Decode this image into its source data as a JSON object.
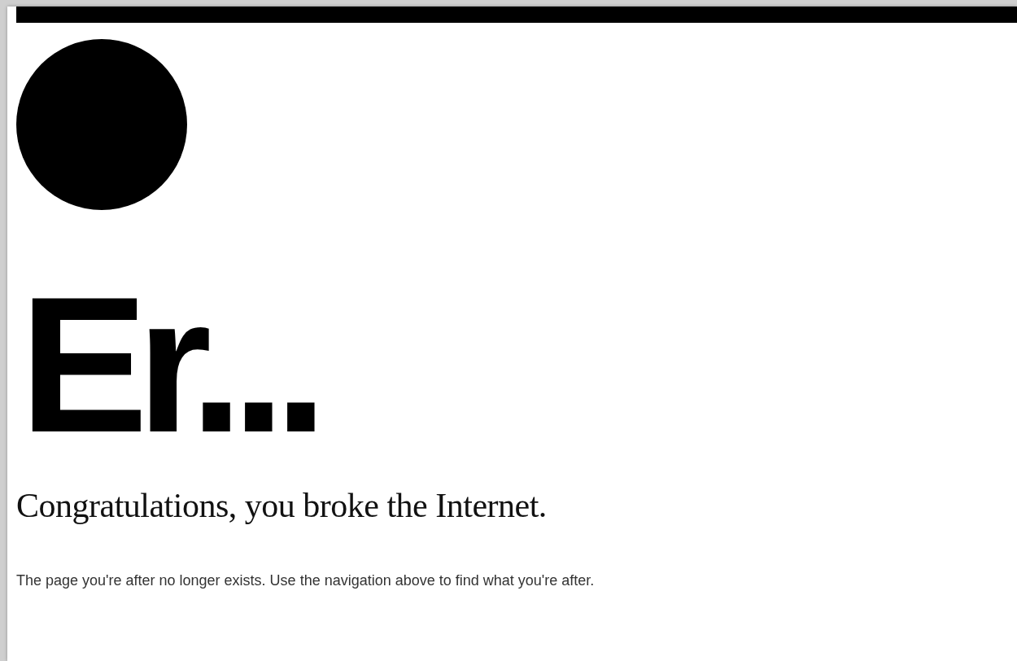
{
  "heading": "Er...",
  "subheading": "Congratulations, you broke the Internet.",
  "message": "The page you're after no longer exists. Use the navigation above to find what you're after."
}
